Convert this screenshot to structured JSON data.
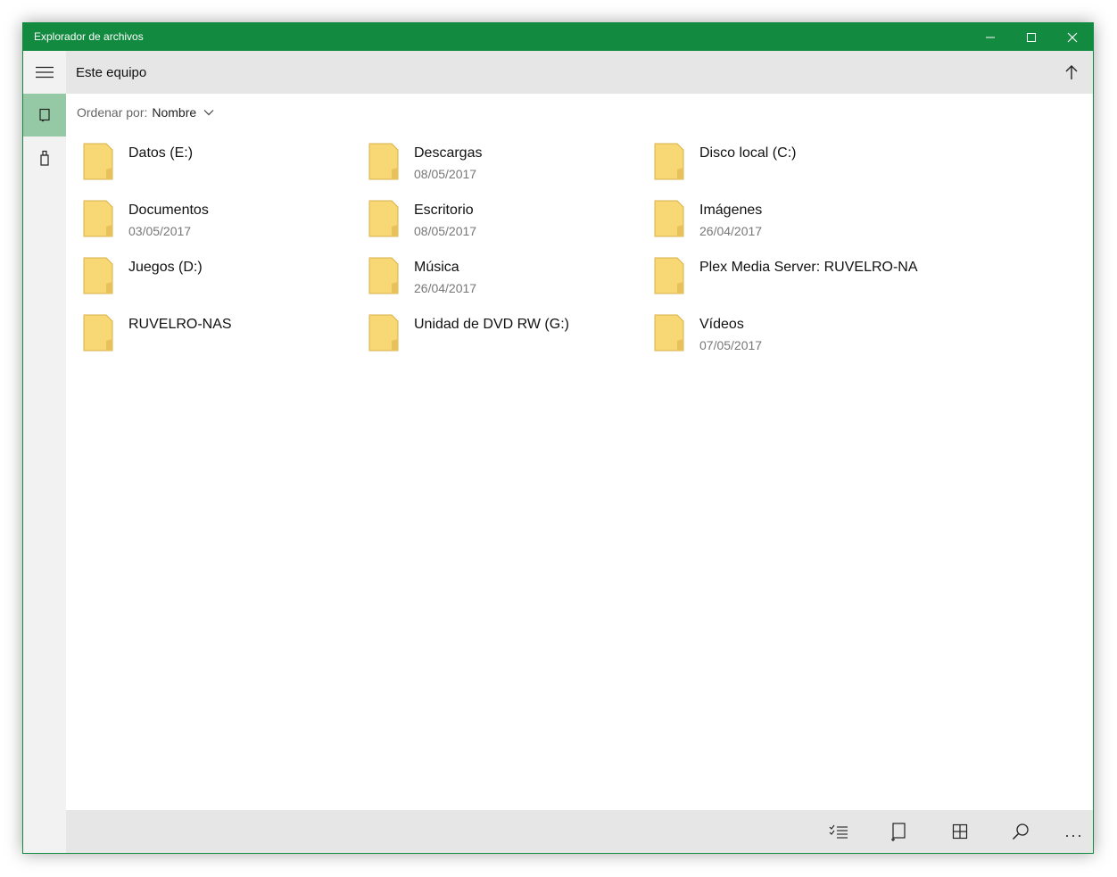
{
  "window": {
    "title": "Explorador de archivos"
  },
  "header": {
    "title": "Este equipo"
  },
  "sort": {
    "label": "Ordenar por:",
    "value": "Nombre"
  },
  "items": [
    {
      "name": "Datos (E:)",
      "date": ""
    },
    {
      "name": "Descargas",
      "date": "08/05/2017"
    },
    {
      "name": "Disco local (C:)",
      "date": ""
    },
    {
      "name": "Documentos",
      "date": "03/05/2017"
    },
    {
      "name": "Escritorio",
      "date": "08/05/2017"
    },
    {
      "name": "Imágenes",
      "date": "26/04/2017"
    },
    {
      "name": "Juegos (D:)",
      "date": ""
    },
    {
      "name": "Música",
      "date": "26/04/2017"
    },
    {
      "name": "Plex Media Server: RUVELRO-NA",
      "date": ""
    },
    {
      "name": "RUVELRO-NAS",
      "date": ""
    },
    {
      "name": "Unidad de DVD RW (G:)",
      "date": ""
    },
    {
      "name": "Vídeos",
      "date": "07/05/2017"
    }
  ],
  "colors": {
    "accent": "#128a3f",
    "nav_selected": "#95c9a5",
    "folder": "#f8d775"
  },
  "icons": {
    "menu": "hamburger-icon",
    "up": "arrow-up-icon",
    "nav_device": "tablet-icon",
    "nav_usb": "usb-drive-icon",
    "bottom": [
      "select-list-icon",
      "new-device-icon",
      "grid-view-icon",
      "search-icon",
      "more-icon"
    ]
  },
  "bottombar": {
    "more_label": "..."
  }
}
